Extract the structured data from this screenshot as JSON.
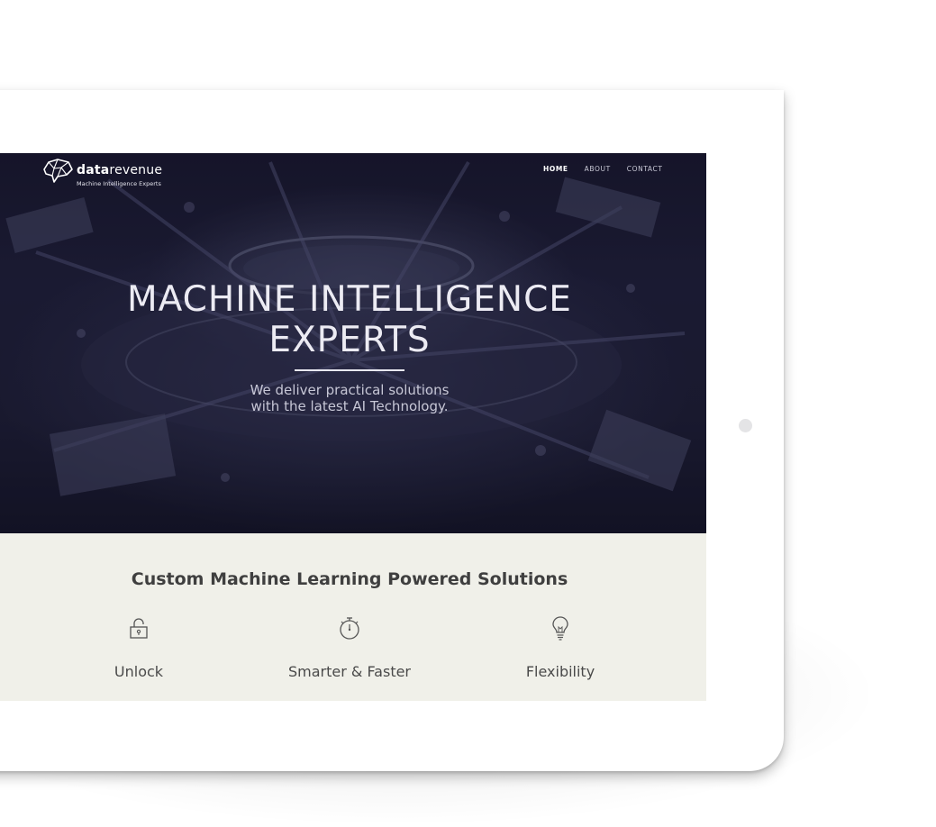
{
  "brand": {
    "name_bold": "data",
    "name_light": "revenue",
    "tagline": "Machine Intelligence Experts"
  },
  "nav": {
    "items": [
      {
        "label": "HOME",
        "active": true
      },
      {
        "label": "ABOUT",
        "active": false
      },
      {
        "label": "CONTACT",
        "active": false
      }
    ]
  },
  "hero": {
    "title_line1": "MACHINE INTELLIGENCE",
    "title_line2": "EXPERTS",
    "subtitle_line1": "We deliver practical solutions",
    "subtitle_line2": "with the latest AI Technology."
  },
  "features": {
    "title": "Custom Machine Learning Powered Solutions",
    "items": [
      {
        "label": "Unlock",
        "icon": "padlock-icon"
      },
      {
        "label": "Smarter & Faster",
        "icon": "stopwatch-icon"
      },
      {
        "label": "Flexibility",
        "icon": "lightbulb-icon"
      }
    ]
  },
  "colors": {
    "hero_bg": "#1b1b31",
    "section_bg": "#f0f0e9",
    "device": "#ffffff"
  }
}
